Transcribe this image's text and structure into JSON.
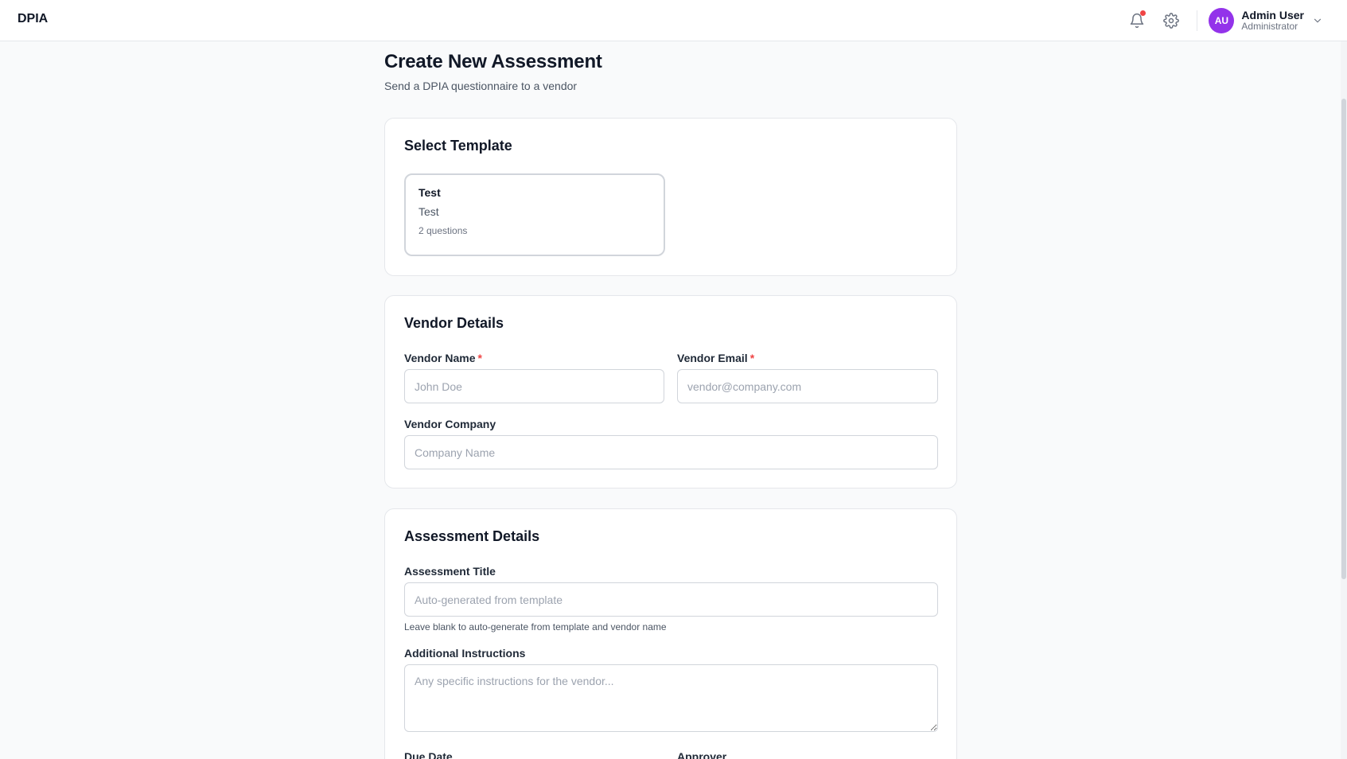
{
  "app": {
    "brand": "DPIA"
  },
  "user": {
    "initials": "AU",
    "name": "Admin User",
    "role": "Administrator"
  },
  "page": {
    "title": "Create New Assessment",
    "subtitle": "Send a DPIA questionnaire to a vendor"
  },
  "template_section": {
    "title": "Select Template",
    "templates": [
      {
        "name": "Test",
        "description": "Test",
        "questions": "2 questions"
      }
    ]
  },
  "vendor_section": {
    "title": "Vendor Details",
    "name_label": "Vendor Name",
    "name_placeholder": "John Doe",
    "email_label": "Vendor Email",
    "email_placeholder": "vendor@company.com",
    "company_label": "Vendor Company",
    "company_placeholder": "Company Name",
    "required_mark": "*"
  },
  "assessment_section": {
    "title": "Assessment Details",
    "title_label": "Assessment Title",
    "title_placeholder": "Auto-generated from template",
    "title_hint": "Leave blank to auto-generate from template and vendor name",
    "instructions_label": "Additional Instructions",
    "instructions_placeholder": "Any specific instructions for the vendor...",
    "due_date_label": "Due Date",
    "approver_label": "Approver"
  },
  "colors": {
    "accent": "#9333ea",
    "required": "#ef4444",
    "notification": "#ef4444"
  }
}
